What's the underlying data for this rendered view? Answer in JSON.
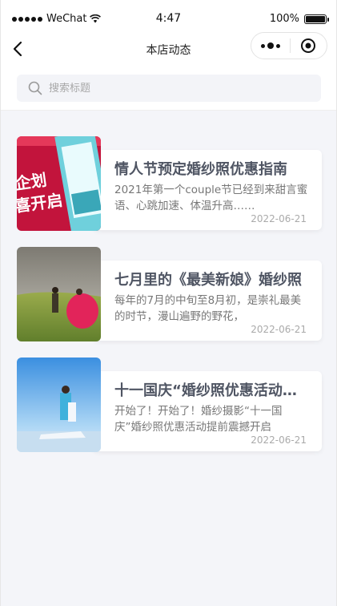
{
  "status_bar": {
    "carrier": "WeChat",
    "time": "4:47",
    "battery": "100%",
    "battery_level": 1.0
  },
  "nav": {
    "title": "本店动态",
    "back_icon": "chevron-left-icon",
    "more_icon": "more-dots-icon",
    "close_icon": "target-close-icon"
  },
  "search": {
    "placeholder": "搜索标题",
    "value": ""
  },
  "articles": [
    {
      "title": "情人节预定婚纱照优惠指南",
      "desc": "2021年第一个couple节已经到来甜言蜜语、心跳加速、体温升高……",
      "date": "2022-06-21"
    },
    {
      "title": "七月里的《最美新娘》婚纱照",
      "desc": "每年的7月的中旬至8月初，是崇礼最美的时节，漫山遍野的野花，",
      "date": "2022-06-21"
    },
    {
      "title": "十一国庆“婚纱照优惠活动提前",
      "desc": "开始了！开始了！婚纱摄影“十一国庆”婚纱照优惠活动提前震撼开启",
      "date": "2022-06-21"
    }
  ],
  "colors": {
    "background": "#f4f5f9",
    "title": "#4f5563",
    "date": "#aaaaaa"
  }
}
